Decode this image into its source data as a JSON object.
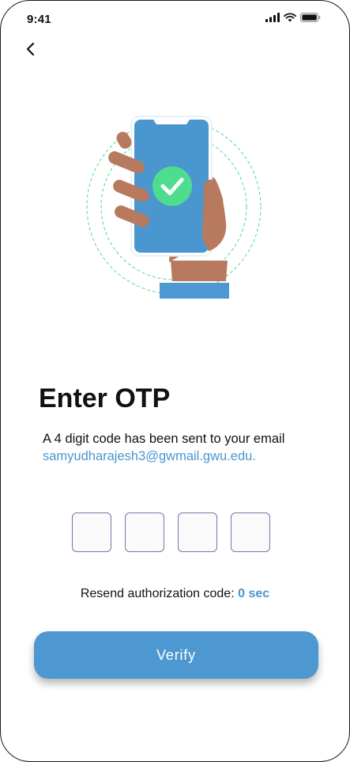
{
  "status_bar": {
    "time": "9:41",
    "icons": [
      "signal-icon",
      "wifi-icon",
      "battery-icon"
    ]
  },
  "back": {
    "icon": "chevron-left-icon"
  },
  "illustration": {
    "name": "phone-otp-illustration",
    "colors": {
      "phone": "#4a96cf",
      "check": "#4edc8f",
      "skin": "#b77a5e",
      "cuff": "#4e98d2",
      "ring": "#4edc8f"
    }
  },
  "title": "Enter OTP",
  "subtitle": "A 4 digit code has been sent to your email",
  "email": "samyudharajesh3@gwmail.gwu.edu.",
  "otp": {
    "digits": 4,
    "values": [
      "",
      "",
      "",
      ""
    ]
  },
  "resend": {
    "label": "Resend authorization code:",
    "timer": "0 sec"
  },
  "verify_button": {
    "label": "Verify"
  },
  "colors": {
    "accent": "#4e98d2",
    "link": "#4a96cf",
    "box_border": "#7c74a8"
  }
}
